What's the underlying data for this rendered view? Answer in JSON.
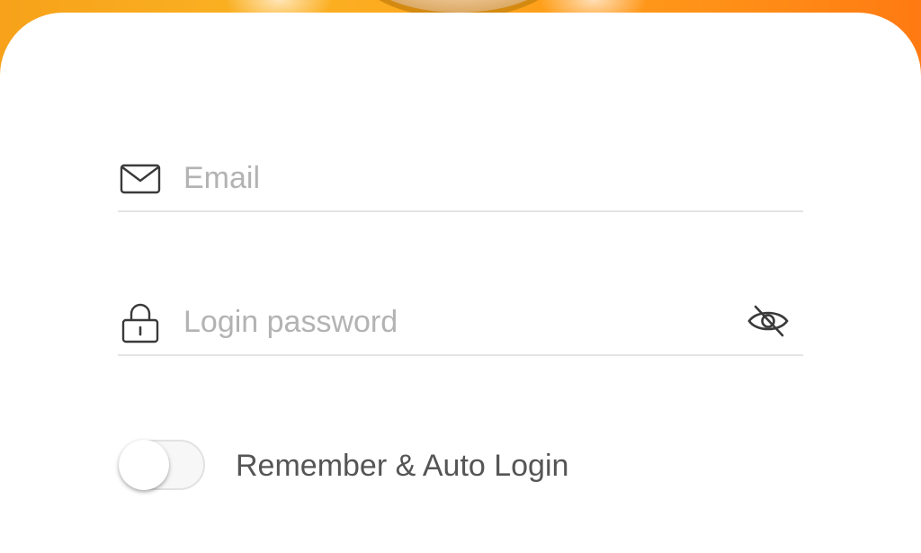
{
  "header": {
    "art": "orange-banner-with-orb"
  },
  "form": {
    "email": {
      "icon": "envelope-icon",
      "placeholder": "Email",
      "value": ""
    },
    "password": {
      "icon": "lock-icon",
      "placeholder": "Login password",
      "value": "",
      "visibility_icon": "eye-off-icon"
    },
    "remember": {
      "label": "Remember & Auto Login",
      "checked": false
    }
  },
  "colors": {
    "accent": "#ff8a16",
    "placeholder": "#b3b3b3",
    "label": "#555555",
    "divider": "#e4e4e4"
  }
}
